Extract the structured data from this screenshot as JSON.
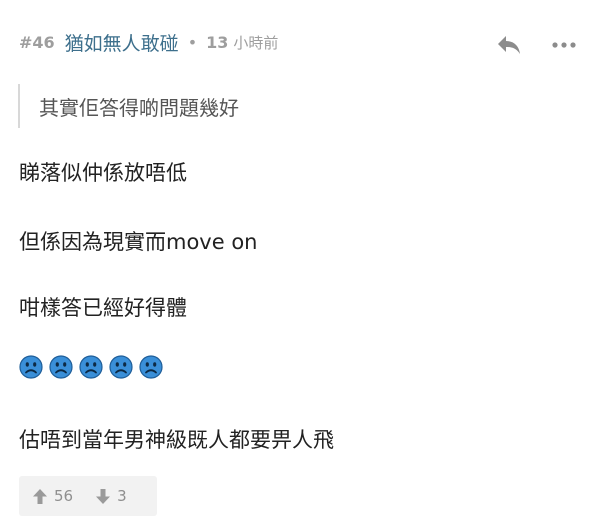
{
  "post": {
    "number": "#46",
    "username": "猶如無人敢碰",
    "separator": "•",
    "time_value": "13",
    "time_unit": "小時前"
  },
  "actions": {
    "reply_icon": "reply-icon",
    "more_icon": "more-icon"
  },
  "quote": {
    "text": "其實佢答得啲問題幾好"
  },
  "body": {
    "lines": [
      "睇落似仲係放唔低",
      "但係因為現實而move on",
      "咁樣答已經好得體",
      "估唔到當年男神級既人都要畀人飛"
    ],
    "emojis": [
      "sad-face",
      "sad-face",
      "sad-face",
      "sad-face",
      "sad-face"
    ]
  },
  "votes": {
    "up_count": "56",
    "down_count": "3"
  },
  "colors": {
    "username": "#3d6f8c",
    "meta_gray": "#9e9e9e",
    "emoji_blue": "#3a8fd8",
    "vote_bg": "#f2f2f2"
  }
}
